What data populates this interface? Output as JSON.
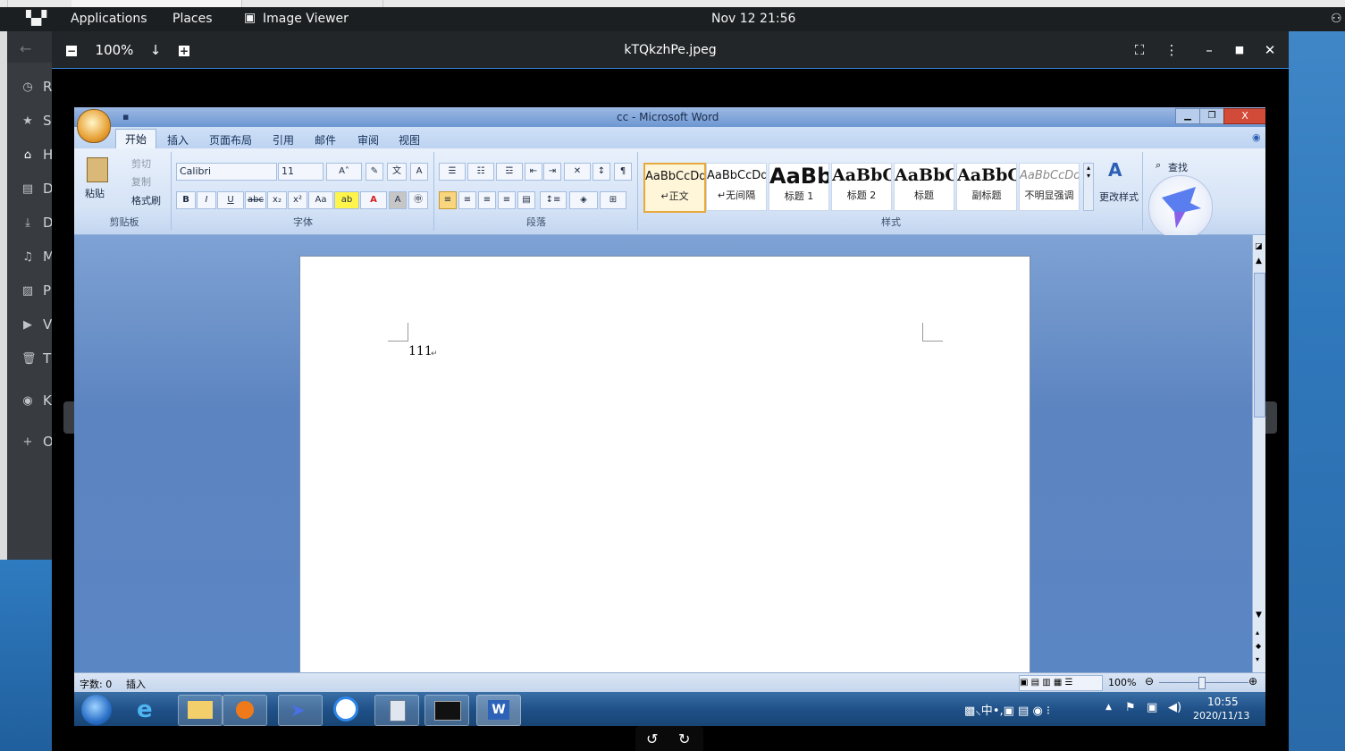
{
  "gnome_panel": {
    "applications": "Applications",
    "places": "Places",
    "app_name": "Image Viewer",
    "clock": "Nov 12  21:56"
  },
  "file_manager_sidebar": {
    "letters": [
      "R",
      "S",
      "H",
      "D",
      "D",
      "M",
      "P",
      "V",
      "T",
      "K",
      "O"
    ]
  },
  "viewer": {
    "zoom": "100%",
    "title": "kTQkzhPe.jpeg"
  },
  "word": {
    "window_title": "cc - Microsoft Word",
    "tabs": [
      "开始",
      "插入",
      "页面布局",
      "引用",
      "邮件",
      "审阅",
      "视图"
    ],
    "clipboard": {
      "paste": "粘贴",
      "cut": "剪切",
      "copy": "复制",
      "format_painter": "格式刷",
      "label": "剪贴板"
    },
    "font": {
      "name": "Calibri",
      "size": "11",
      "label": "字体"
    },
    "paragraph": {
      "label": "段落"
    },
    "styles": {
      "items": [
        {
          "preview": "AaBbCcDd",
          "name": "↵正文"
        },
        {
          "preview": "AaBbCcDd",
          "name": "↵无间隔"
        },
        {
          "preview": "AaBb",
          "name": "标题 1"
        },
        {
          "preview": "AaBbC",
          "name": "标题 2"
        },
        {
          "preview": "AaBbC",
          "name": "标题"
        },
        {
          "preview": "AaBbC",
          "name": "副标题"
        },
        {
          "preview": "AaBbCcDd",
          "name": "不明显强调"
        }
      ],
      "change": "更改样式",
      "label": "样式"
    },
    "find": "查找",
    "doc_text": "111",
    "status_words": "字数: 0",
    "status_insert": "插入",
    "zoom": "100%"
  },
  "win7_taskbar": {
    "time": "10:55",
    "date": "2020/11/13",
    "ime": "中"
  },
  "colors": {
    "accent": "#3583d5",
    "panel": "#1c1f22"
  }
}
